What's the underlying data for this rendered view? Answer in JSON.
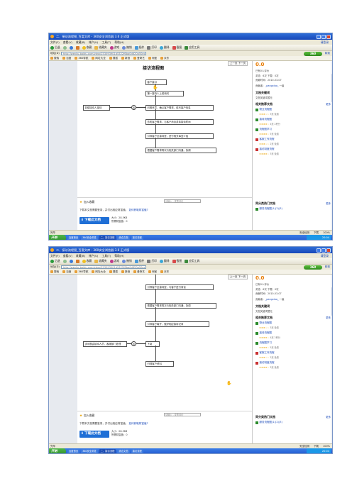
{
  "screenshots": [
    {
      "browser": {
        "window_title": "二、接访流程图_百度文库 - 360安全浏览器 3.6 正式版",
        "menu": [
          "文件(F)",
          "查看(V)",
          "收藏(B)",
          "帐户(U)",
          "工具(T)",
          "帮助(H)"
        ],
        "login_label": "请登录",
        "toolbar": [
          "后退",
          "前进",
          "刷新",
          "主页",
          "收藏",
          "收藏夹",
          "游戏",
          "撤销",
          "插件",
          "打印",
          "翻译",
          "截图",
          "应用工具"
        ],
        "address_label": "地址(D)",
        "address": "http://wenku.baidu.com/view/253593901d5322f6ba0d620a50ec3474",
        "address_go": "转到",
        "brand": "360",
        "favorites_label": "搜索",
        "favorites": [
          "搜索",
          "百度",
          "360导航",
          "网址大全",
          "搜狐",
          "新浪",
          "爱奇艺",
          "淘宝",
          "京东"
        ]
      },
      "doc": {
        "title": "接访流程图",
        "nav_label": "上一页 下一页"
      },
      "sidebar": {
        "score": "0.0",
        "rating_text": "已有0人评价",
        "stats": "浏览：6次  下载：0次",
        "date": "贡献时间：2010-03-07",
        "contributor_label": "贡献者：",
        "contributor": "_pangxiao_",
        "level": "  一级",
        "keywords_head": "文档关键词",
        "keywords_text": "文档关键词暂无",
        "related_head": "相关推荐文档",
        "related_more": "更多",
        "related": [
          {
            "name": "物业流程图",
            "meta": "3页  免费",
            "stars": "★★★☆☆"
          },
          {
            "name": "接待流程图",
            "meta": "4页  2积分",
            "stars": "★★★★☆"
          },
          {
            "name": "流程图学习",
            "meta": "5页  免费",
            "stars": "★★★★☆"
          },
          {
            "name": "客服工作流程",
            "meta": "2页  免费",
            "stars": "★★★☆☆"
          },
          {
            "name": "接访制度流程",
            "meta": "3页  免费",
            "stars": "★★★★☆"
          }
        ],
        "same_author_head": "同分类热门文档",
        "same_author_more": "更多",
        "same_author_first": "服务流程图(1)(2)(3)"
      },
      "footer": {
        "fav_label": "加入收藏",
        "comment_placeholder": "请输入 . 发表评论",
        "tip": "下载本文档需要登录，并付出相应财富值。",
        "tip_link": "如何获取财富值?",
        "download_label": "下载此文档",
        "file_size": "大小：28.5KB",
        "cost": "所需财富值：0"
      },
      "status": {
        "done": "完毕",
        "right_items": [
          "安全检测",
          "下载",
          "100%"
        ]
      },
      "taskbar": {
        "start": "开始",
        "tasks": [
          "百度首页",
          "360安全浏览",
          "二、接访流程",
          "综合文档",
          "接访流程"
        ],
        "clock": "20:04"
      },
      "flow": {
        "steps": [
          "客户接口",
          "第一接待人上前询问",
          "问明来意，确认客户需求，填写客户信息",
          "告知客户需求，与客户商谈具体接待时间",
          "引导客户至接待室，进行相关事宜介绍",
          "根据客户需求再次与相关部门沟通，协调"
        ],
        "side": "协助接待人接待",
        "circle": "否"
      }
    },
    {
      "browser": {
        "window_title": "二、接访流程图_百度文库 - 360安全浏览器 3.6 正式版",
        "menu": [
          "文件(F)",
          "查看(V)",
          "收藏(B)",
          "帐户(U)",
          "工具(T)",
          "帮助(H)"
        ],
        "login_label": "请登录",
        "toolbar": [
          "后退",
          "前进",
          "刷新",
          "主页",
          "收藏",
          "收藏夹",
          "游戏",
          "撤销",
          "插件",
          "打印",
          "翻译",
          "截图",
          "应用工具"
        ],
        "address_label": "地址(D)",
        "address": "http://wenku.baidu.com/view/253593901d5322f6ba0d620a50ec3474",
        "address_go": "转到",
        "brand": "360",
        "favorites_label": "搜索",
        "favorites": [
          "搜索",
          "百度",
          "360导航",
          "网址大全",
          "搜狐",
          "新浪",
          "爱奇艺",
          "淘宝",
          "京东"
        ]
      },
      "doc": {
        "title": "",
        "nav_label": "上一页 下一页"
      },
      "sidebar": {
        "score": "0.0",
        "rating_text": "已有0人评价",
        "stats": "浏览：6次  下载：0次",
        "date": "贡献时间：2010-03-07",
        "contributor_label": "贡献者：",
        "contributor": "_pangxiao_",
        "level": "  一级",
        "keywords_head": "文档关键词",
        "keywords_text": "文档关键词暂无",
        "related_head": "相关推荐文档",
        "related_more": "更多",
        "related": [
          {
            "name": "物业流程图",
            "meta": "3页  免费",
            "stars": "★★★☆☆"
          },
          {
            "name": "接待流程图",
            "meta": "4页  2积分",
            "stars": "★★★★☆"
          },
          {
            "name": "流程图学习",
            "meta": "5页  免费",
            "stars": "★★★★☆"
          },
          {
            "name": "客服工作流程",
            "meta": "2页  免费",
            "stars": "★★★☆☆"
          },
          {
            "name": "接访制度流程",
            "meta": "3页  免费",
            "stars": "★★★★☆"
          }
        ],
        "same_author_head": "同分类热门文档",
        "same_author_more": "更多",
        "same_author_first": "服务流程图(1)(2)(3)"
      },
      "footer": {
        "fav_label": "加入收藏",
        "comment_placeholder": "请输入 . 发表评论",
        "tip": "下载本文档需要登录，并付出相应财富值。",
        "tip_link": "如何获取财富值?",
        "download_label": "下载此文档",
        "file_size": "大小：28.5KB",
        "cost": "所需财富值：0"
      },
      "status": {
        "done": "完毕",
        "right_items": [
          "安全检测",
          "下载",
          "100%"
        ]
      },
      "taskbar": {
        "start": "开始",
        "tasks": [
          "百度首页",
          "360安全浏览",
          "二、接访流程",
          "综合文档",
          "接访流程"
        ],
        "clock": "20:04"
      },
      "flow": {
        "steps": [
          "引导客户至接待室，与客户进行商谈",
          "根据客户需求再次与相关部门沟通，协调",
          "引导客户离开，做好相应接待记录",
          "下岗",
          "归档客户资料"
        ],
        "side": "该问题由接待人员，客服部门处理",
        "circle": "否"
      }
    }
  ]
}
